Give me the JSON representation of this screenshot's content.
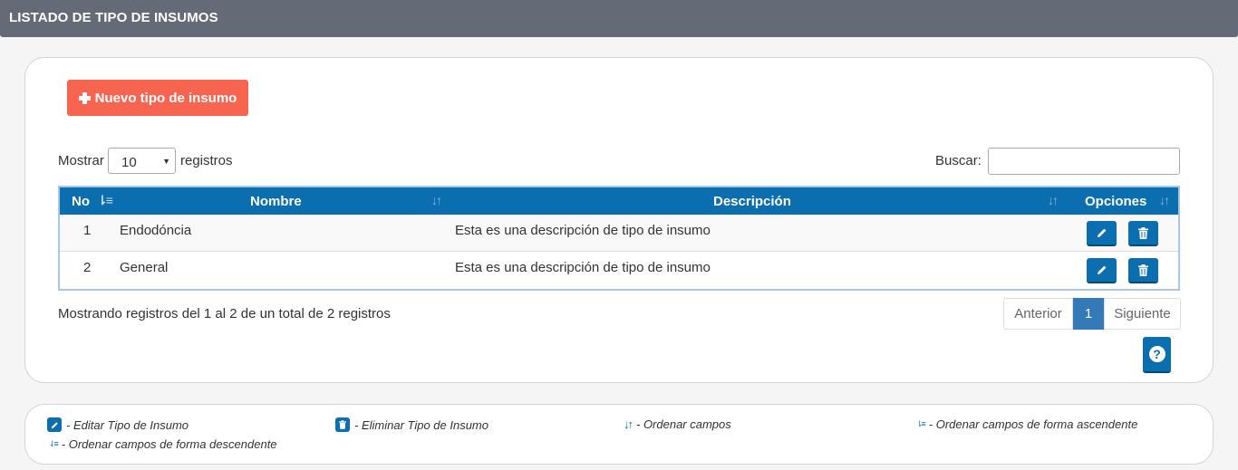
{
  "header": {
    "title": "LISTADO DE TIPO DE INSUMOS"
  },
  "toolbar": {
    "new_label": "Nuevo tipo de insumo"
  },
  "length": {
    "prefix": "Mostrar",
    "value": "10",
    "suffix": "registros"
  },
  "search": {
    "label": "Buscar:",
    "value": ""
  },
  "table": {
    "columns": [
      "No",
      "Nombre",
      "Descripción",
      "Opciones"
    ],
    "rows": [
      {
        "no": "1",
        "nombre": "Endodóncia",
        "descripcion": "Esta es una descripción de tipo de insumo"
      },
      {
        "no": "2",
        "nombre": "General",
        "descripcion": "Esta es una descripción de tipo de insumo"
      }
    ]
  },
  "info": "Mostrando registros del 1 al 2 de un total de 2 registros",
  "pagination": {
    "prev": "Anterior",
    "current": "1",
    "next": "Siguiente"
  },
  "legend": {
    "edit": "- Editar Tipo de Insumo",
    "delete": "- Eliminar Tipo de Insumo",
    "sort": "- Ordenar campos",
    "asc": "- Ordenar campos de forma ascendente",
    "desc": "- Ordenar campos de forma descendente"
  },
  "colors": {
    "header_bar": "#646b77",
    "primary": "#0b6eae",
    "new_button": "#f76551",
    "page_active": "#337ab7"
  }
}
